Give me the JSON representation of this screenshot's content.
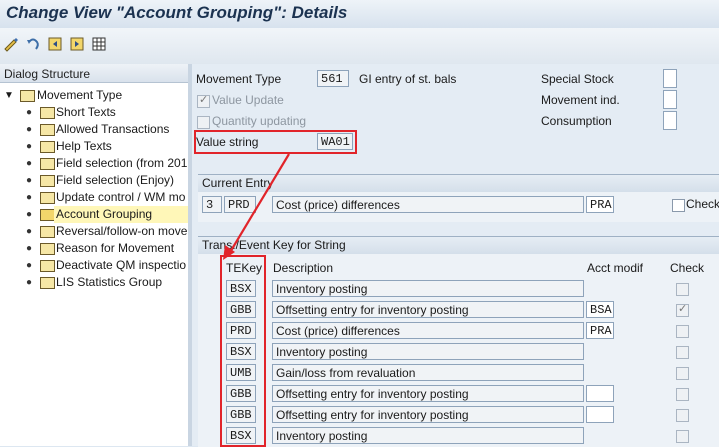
{
  "window": {
    "title": "Change View \"Account Grouping\": Details"
  },
  "toolbar": {
    "icons": [
      "edit-icon",
      "undo-icon",
      "prev-entry-icon",
      "next-entry-icon",
      "grid-icon"
    ]
  },
  "tree": {
    "header": "Dialog Structure",
    "root": "Movement Type",
    "items": [
      "Short Texts",
      "Allowed Transactions",
      "Help Texts",
      "Field selection (from 201",
      "Field selection (Enjoy)",
      "Update control / WM mo",
      "Account Grouping",
      "Reversal/follow-on move",
      "Reason for Movement",
      "Deactivate QM inspectio",
      "LIS Statistics Group"
    ]
  },
  "form": {
    "movement_type_label": "Movement Type",
    "movement_type_value": "561",
    "movement_type_text": "GI entry of st. bals",
    "value_update_label": "Value Update",
    "quantity_updating_label": "Quantity updating",
    "value_string_label": "Value string",
    "value_string_value": "WA01",
    "special_stock_label": "Special Stock",
    "movement_ind_label": "Movement ind.",
    "consumption_label": "Consumption"
  },
  "current_entry": {
    "title": "Current Entry",
    "number": "3",
    "key": "PRD",
    "description": "Cost (price) differences",
    "acct_modif": "PRA",
    "check_label": "Check"
  },
  "trans_key": {
    "title": "Trans./Event Key for String",
    "headers": {
      "tekey": "TEKey",
      "description": "Description",
      "acct_modif": "Acct modif",
      "check": "Check"
    },
    "rows": [
      {
        "tekey": "BSX",
        "description": "Inventory posting",
        "acct": ""
      },
      {
        "tekey": "GBB",
        "description": "Offsetting entry for inventory posting",
        "acct": "BSA"
      },
      {
        "tekey": "PRD",
        "description": "Cost (price) differences",
        "acct": "PRA"
      },
      {
        "tekey": "BSX",
        "description": "Inventory posting",
        "acct": ""
      },
      {
        "tekey": "UMB",
        "description": "Gain/loss from revaluation",
        "acct": ""
      },
      {
        "tekey": "GBB",
        "description": "Offsetting entry for inventory posting",
        "acct": ""
      },
      {
        "tekey": "GBB",
        "description": "Offsetting entry for inventory posting",
        "acct": ""
      },
      {
        "tekey": "BSX",
        "description": "Inventory posting",
        "acct": ""
      }
    ]
  },
  "colors": {
    "highlight": "#e1242a",
    "selected_tree_item": "#fff7b8"
  }
}
